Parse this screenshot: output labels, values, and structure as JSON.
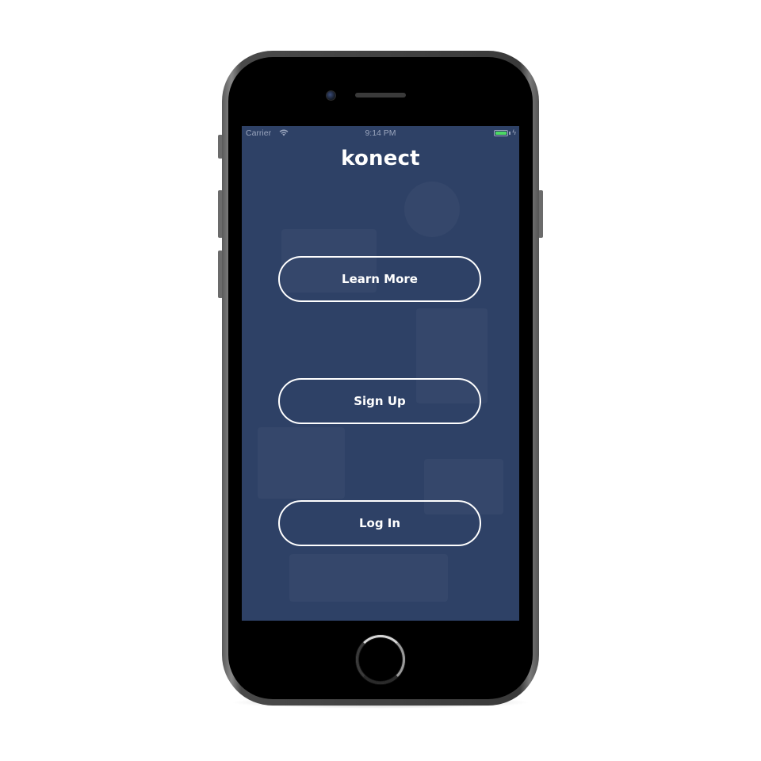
{
  "status_bar": {
    "carrier": "Carrier",
    "time": "9:14 PM",
    "wifi_icon": "wifi-icon",
    "battery_icon": "battery-icon",
    "battery_color": "#4cd964",
    "charging_glyph": "ϟ"
  },
  "app": {
    "title": "konect",
    "background_color": "#2e4166"
  },
  "buttons": {
    "learn_more": "Learn More",
    "sign_up": "Sign Up",
    "log_in": "Log In"
  }
}
